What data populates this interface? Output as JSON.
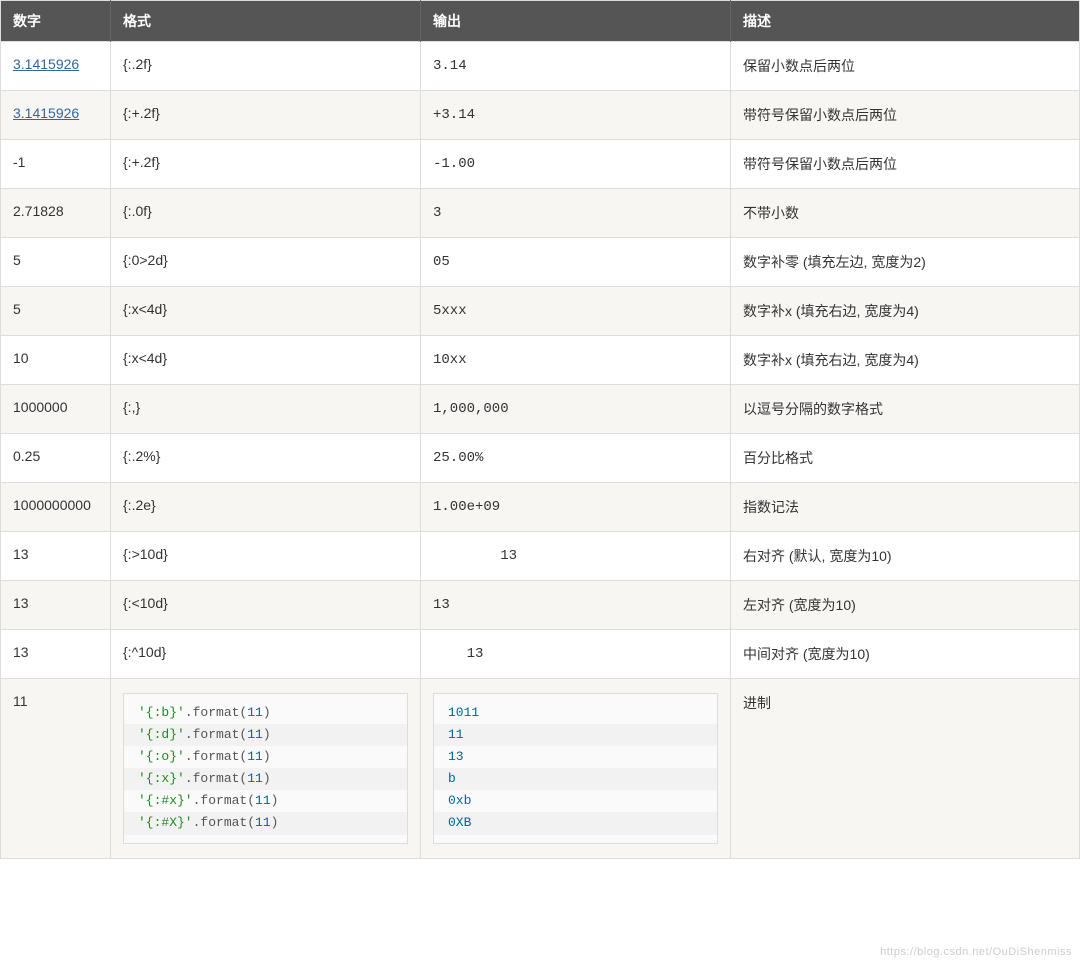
{
  "headers": {
    "number": "数字",
    "format": "格式",
    "output": "输出",
    "description": "描述"
  },
  "rows": [
    {
      "number": "3.1415926",
      "link": true,
      "format": "{:.2f}",
      "output": "3.14",
      "description": "保留小数点后两位"
    },
    {
      "number": "3.1415926",
      "link": true,
      "format": "{:+.2f}",
      "output": "+3.14",
      "description": "带符号保留小数点后两位"
    },
    {
      "number": "-1",
      "link": false,
      "format": "{:+.2f}",
      "output": "-1.00",
      "description": "带符号保留小数点后两位"
    },
    {
      "number": "2.71828",
      "link": false,
      "format": "{:.0f}",
      "output": "3",
      "description": "不带小数"
    },
    {
      "number": "5",
      "link": false,
      "format": "{:0>2d}",
      "output": "05",
      "description": "数字补零 (填充左边, 宽度为2)"
    },
    {
      "number": "5",
      "link": false,
      "format": "{:x<4d}",
      "output": "5xxx",
      "description": "数字补x (填充右边, 宽度为4)"
    },
    {
      "number": "10",
      "link": false,
      "format": "{:x<4d}",
      "output": "10xx",
      "description": "数字补x (填充右边, 宽度为4)"
    },
    {
      "number": "1000000",
      "link": false,
      "format": "{:,}",
      "output": "1,000,000",
      "description": "以逗号分隔的数字格式"
    },
    {
      "number": "0.25",
      "link": false,
      "format": "{:.2%}",
      "output": "25.00%",
      "description": "百分比格式"
    },
    {
      "number": "1000000000",
      "link": false,
      "format": "{:.2e}",
      "output": "1.00e+09",
      "description": "指数记法"
    },
    {
      "number": "13",
      "link": false,
      "format": "{:>10d}",
      "output": "        13",
      "description": "右对齐 (默认, 宽度为10)"
    },
    {
      "number": "13",
      "link": false,
      "format": "{:<10d}",
      "output": "13",
      "description": "左对齐 (宽度为10)"
    },
    {
      "number": "13",
      "link": false,
      "format": "{:^10d}",
      "output": "    13",
      "description": "中间对齐 (宽度为10)"
    }
  ],
  "code_row": {
    "number": "11",
    "description": "进制",
    "format_lines": [
      {
        "str": "'{:b}'",
        "fn": ".format(",
        "num": "11",
        "close": ")"
      },
      {
        "str": "'{:d}'",
        "fn": ".format(",
        "num": "11",
        "close": ")"
      },
      {
        "str": "'{:o}'",
        "fn": ".format(",
        "num": "11",
        "close": ")"
      },
      {
        "str": "'{:x}'",
        "fn": ".format(",
        "num": "11",
        "close": ")"
      },
      {
        "str": "'{:#x}'",
        "fn": ".format(",
        "num": "11",
        "close": ")"
      },
      {
        "str": "'{:#X}'",
        "fn": ".format(",
        "num": "11",
        "close": ")"
      }
    ],
    "output_lines": [
      "1011",
      "11",
      "13",
      "b",
      "0xb",
      "0XB"
    ]
  },
  "watermark": "https://blog.csdn.net/OuDiShenmiss"
}
